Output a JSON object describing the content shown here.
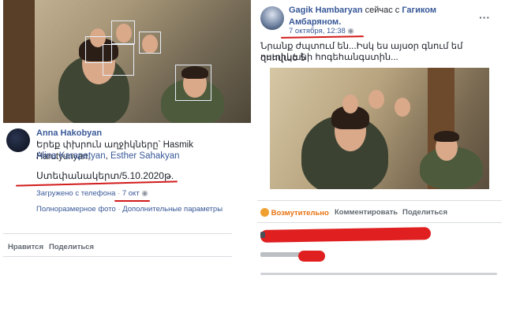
{
  "left_post": {
    "author": "Anna Hakobyan",
    "caption_line1": "Երեք փխրուն աղջիկները՝ Hasmik Harutyunyan,",
    "caption_tag2": "Alina Karapetyan",
    "caption_sep": ",",
    "caption_tag3": "Esther Sahakyan",
    "location_date": "Ստեփանակերտ/5.10.2020թ.",
    "uploaded": "Загружено с телефона",
    "dot": "·",
    "date": "7 окт",
    "fullsize": "Полноразмерное фото",
    "more_options": "Дополнительные параметры",
    "like": "Нравится",
    "share": "Поделиться"
  },
  "right_post": {
    "author": "Gagik Hambaryan",
    "with_text": "сейчас с",
    "with_author": "Гагиком Амбаряном.",
    "timestamp": "7 октября, 12:38",
    "body_line1": "Նրանք ժպտում են...Իսկ ես այսօր գնում եմ զոհված 5",
    "body_line2": "ոստիկանի հոգեհանգստին...",
    "reaction": "Возмутительно",
    "comment": "Комментировать",
    "share": "Поделиться"
  },
  "colors": {
    "link": "#385898",
    "red_mark": "#d21b1b",
    "angry": "#e9710f"
  }
}
